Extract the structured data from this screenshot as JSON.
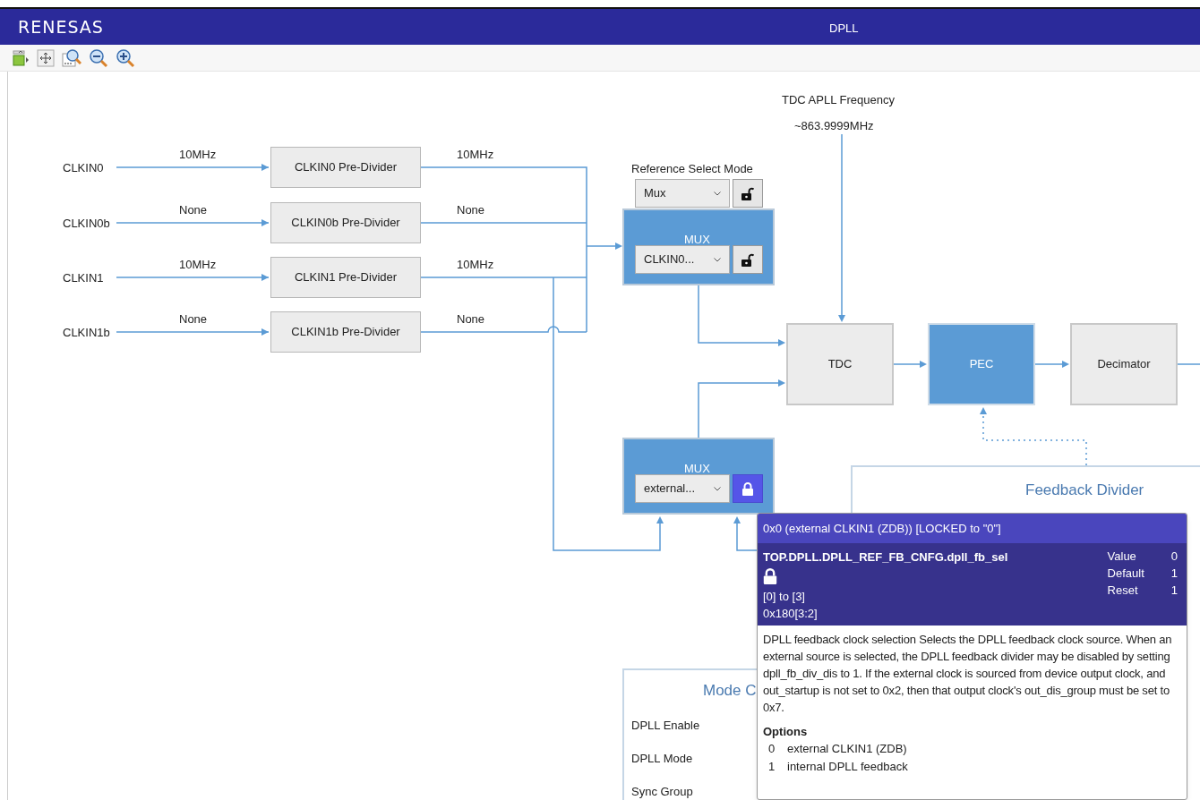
{
  "window": {
    "logo": "RENESAS",
    "title": "DPLL"
  },
  "inputs": [
    {
      "label": "CLKIN0",
      "in_freq": "10MHz",
      "divider": "CLKIN0 Pre-Divider",
      "out_freq": "10MHz"
    },
    {
      "label": "CLKIN0b",
      "in_freq": "None",
      "divider": "CLKIN0b Pre-Divider",
      "out_freq": "None"
    },
    {
      "label": "CLKIN1",
      "in_freq": "10MHz",
      "divider": "CLKIN1 Pre-Divider",
      "out_freq": "10MHz"
    },
    {
      "label": "CLKIN1b",
      "in_freq": "None",
      "divider": "CLKIN1b Pre-Divider",
      "out_freq": "None"
    }
  ],
  "tdc_apll": {
    "label": "TDC APLL Frequency",
    "value": "~863.9999MHz"
  },
  "reference_select": {
    "label": "Reference Select Mode",
    "value": "Mux",
    "locked": false
  },
  "ref_mux": {
    "title": "MUX",
    "value": "CLKIN0...",
    "locked": false
  },
  "fb_mux": {
    "title": "MUX",
    "value": "external...",
    "locked": true
  },
  "blocks": [
    {
      "label": "TDC",
      "kind": "plain"
    },
    {
      "label": "PEC",
      "kind": "active"
    },
    {
      "label": "Decimator",
      "kind": "plain"
    }
  ],
  "feedback_divider": {
    "title": "Feedback Divider"
  },
  "mode_control": {
    "title": "Mode C",
    "rows": [
      "DPLL Enable",
      "DPLL Mode",
      "Sync Group"
    ]
  },
  "tooltip": {
    "header": "0x0 (external CLKIN1 (ZDB)) [LOCKED to \"0\"]",
    "register": "TOP.DPLL.DPLL_REF_FB_CNFG.dpll_fb_sel",
    "locked": true,
    "range": "[0] to [3]",
    "address": "0x180[3:2]",
    "values": [
      {
        "label": "Value",
        "value": "0"
      },
      {
        "label": "Default",
        "value": "1"
      },
      {
        "label": "Reset",
        "value": "1"
      }
    ],
    "description": "DPLL feedback clock selection Selects the DPLL feedback clock source. When an external source is selected, the DPLL feedback divider may be disabled by setting dpll_fb_div_dis to 1. If the external clock is sourced from device output clock, and out_startup is not set to 0x2, then that output clock's out_dis_group must be set to 0x7.",
    "options_title": "Options",
    "options": [
      {
        "value": "0",
        "label": "external CLKIN1 (ZDB)"
      },
      {
        "value": "1",
        "label": "internal DPLL feedback"
      }
    ]
  }
}
